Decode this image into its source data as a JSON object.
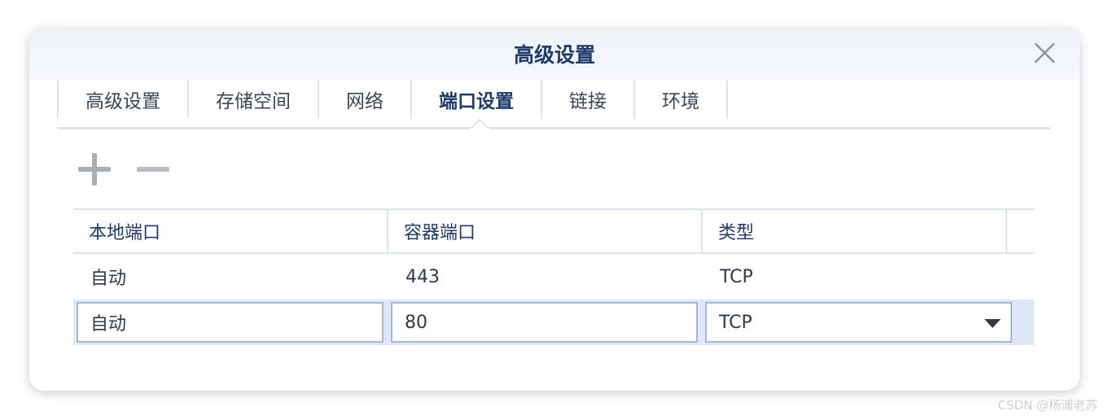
{
  "dialog": {
    "title": "高级设置",
    "close_icon": "close-icon"
  },
  "tabs": [
    {
      "label": "高级设置",
      "active": false
    },
    {
      "label": "存储空间",
      "active": false
    },
    {
      "label": "网络",
      "active": false
    },
    {
      "label": "端口设置",
      "active": true
    },
    {
      "label": "链接",
      "active": false
    },
    {
      "label": "环境",
      "active": false
    }
  ],
  "toolbar": {
    "add_icon": "plus-icon",
    "remove_icon": "minus-icon"
  },
  "table": {
    "headers": [
      "本地端口",
      "容器端口",
      "类型"
    ],
    "rows": [
      {
        "local_port": "自动",
        "container_port": "443",
        "type": "TCP"
      }
    ],
    "edit_row": {
      "local_port": "自动",
      "container_port": "80",
      "type": "TCP"
    }
  },
  "watermark": "CSDN @杨浦老苏",
  "colors": {
    "title": "#1d3b6b",
    "header_text": "#1d3b6b",
    "edit_row_bg": "#dfe8f6",
    "input_border": "#9fb8de"
  }
}
